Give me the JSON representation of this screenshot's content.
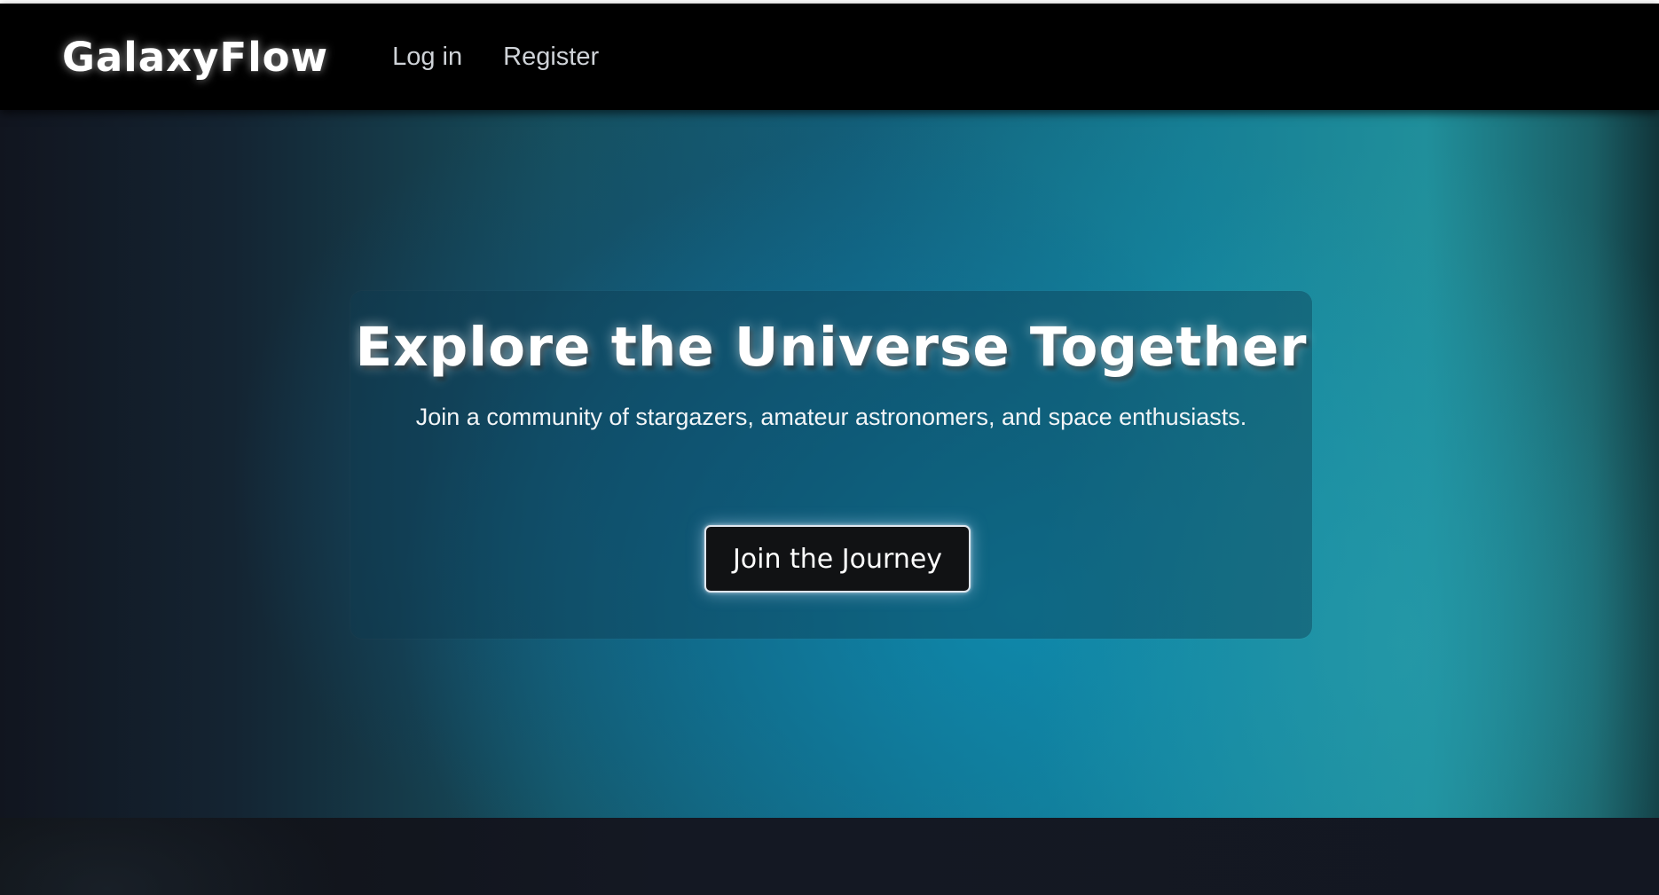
{
  "header": {
    "brand": "GalaxyFlow",
    "nav": {
      "login_label": "Log in",
      "register_label": "Register"
    }
  },
  "hero": {
    "title": "Explore the Universe Together",
    "subtitle": "Join a community of stargazers, amateur astronomers, and space enthusiasts.",
    "cta_label": "Join the Journey"
  },
  "colors": {
    "navbar_bg": "#000000",
    "hero_accent": "#168fa5",
    "button_bg": "#111214",
    "text": "#ffffff"
  }
}
